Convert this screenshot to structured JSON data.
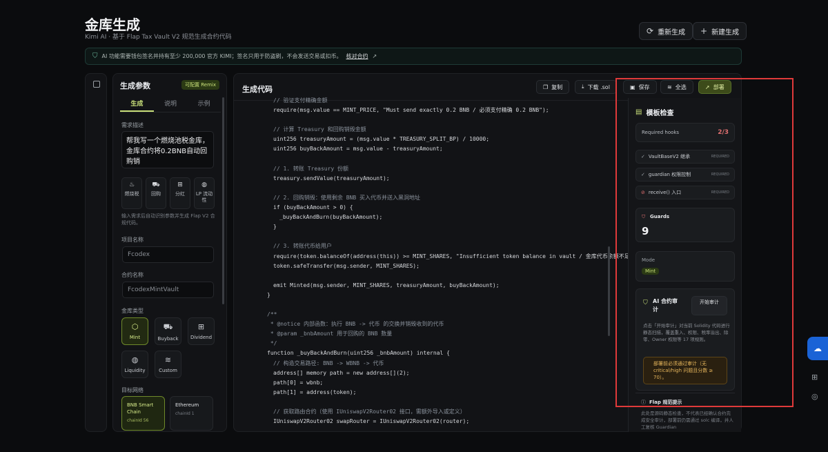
{
  "header": {
    "title": "金库生成",
    "subtitle": "Kimi AI · 基于 Flap Tax Vault V2 规范生成合约代码",
    "regenerate_label": "重新生成",
    "new_label": "新建生成"
  },
  "notice": {
    "text": "AI 功能需要钱包签名并持有至少 200,000 官方 KIMI；签名只用于防盗刷，不会发送交易或扣币。",
    "link": "核对合约"
  },
  "params": {
    "title": "生成参数",
    "badge": "可配置 Remix",
    "tabs": [
      "生成",
      "说明",
      "示例"
    ],
    "request_label": "需求描述",
    "request_value": "帮我写一个燃烧池税金库，金库合约将0.2BNB自动回购销",
    "quick": [
      {
        "icon": "flame-icon",
        "label": "燃烧税"
      },
      {
        "icon": "cart-icon",
        "label": "回购"
      },
      {
        "icon": "gift-icon",
        "label": "分红"
      },
      {
        "icon": "drop-icon",
        "label": "LP 流动性"
      }
    ],
    "hint": "输入需求后自动识别参数并生成 Flap V2 合规代码。",
    "project_label": "项目名称",
    "project_placeholder": "Fcodex",
    "contract_label": "合约名称",
    "contract_placeholder": "FcodexMintVault",
    "vault_label": "金库类型",
    "vault_types": [
      "Mint",
      "Buyback",
      "Dividend",
      "Liquidity",
      "Custom"
    ],
    "network_label": "目标网络",
    "networks": [
      {
        "name": "BNB Smart Chain",
        "chain": "chainId 56"
      },
      {
        "name": "Ethereum",
        "chain": "chainId 1"
      }
    ]
  },
  "code": {
    "title": "生成代码",
    "copy_label": "复制",
    "download_label": "下载 .sol",
    "save_label": "保存",
    "select_all_label": "全选",
    "deploy_label": "部署",
    "lines": [
      {
        "indent": 3,
        "type": "com",
        "text": "// 验证支付精确金额"
      },
      {
        "indent": 3,
        "type": "code",
        "text": "require(msg.value == MINT_PRICE, \"Must send exactly 0.2 BNB / 必须支付精确 0.2 BNB\");"
      },
      {
        "indent": 0,
        "type": "code",
        "text": ""
      },
      {
        "indent": 3,
        "type": "com",
        "text": "// 计算 Treasury 和回购销毁金额"
      },
      {
        "indent": 3,
        "type": "code",
        "text": "uint256 treasuryAmount = (msg.value * TREASURY_SPLIT_BP) / 10000;"
      },
      {
        "indent": 3,
        "type": "code",
        "text": "uint256 buyBackAmount = msg.value - treasuryAmount;"
      },
      {
        "indent": 0,
        "type": "code",
        "text": ""
      },
      {
        "indent": 3,
        "type": "com",
        "text": "// 1. 转账 Treasury 份额"
      },
      {
        "indent": 3,
        "type": "code",
        "text": "treasury.sendValue(treasuryAmount);"
      },
      {
        "indent": 0,
        "type": "code",
        "text": ""
      },
      {
        "indent": 3,
        "type": "com",
        "text": "// 2. 回购销毁：使用剩余 BNB 买入代币并送入黑洞地址"
      },
      {
        "indent": 3,
        "type": "code",
        "text": "if (buyBackAmount > 0) {"
      },
      {
        "indent": 4,
        "type": "code",
        "text": "_buyBackAndBurn(buyBackAmount);"
      },
      {
        "indent": 3,
        "type": "code",
        "text": "}"
      },
      {
        "indent": 0,
        "type": "code",
        "text": ""
      },
      {
        "indent": 3,
        "type": "com",
        "text": "// 3. 转账代币给用户"
      },
      {
        "indent": 3,
        "type": "code",
        "text": "require(token.balanceOf(address(this)) >= MINT_SHARES, \"Insufficient token balance in vault / 金库代币余额不足\");"
      },
      {
        "indent": 3,
        "type": "code",
        "text": "token.safeTransfer(msg.sender, MINT_SHARES);"
      },
      {
        "indent": 0,
        "type": "code",
        "text": ""
      },
      {
        "indent": 3,
        "type": "code",
        "text": "emit Minted(msg.sender, MINT_SHARES, treasuryAmount, buyBackAmount);"
      },
      {
        "indent": 2,
        "type": "code",
        "text": "}"
      },
      {
        "indent": 0,
        "type": "code",
        "text": ""
      },
      {
        "indent": 2,
        "type": "com",
        "text": "/**"
      },
      {
        "indent": 2,
        "type": "com",
        "text": " * @notice 内部函数：执行 BNB -> 代币 的交换并销毁收到的代币"
      },
      {
        "indent": 2,
        "type": "com",
        "text": " * @param _bnbAmount 用于回购的 BNB 数量"
      },
      {
        "indent": 2,
        "type": "com",
        "text": " */"
      },
      {
        "indent": 2,
        "type": "code",
        "text": "function _buyBackAndBurn(uint256 _bnbAmount) internal {"
      },
      {
        "indent": 3,
        "type": "com",
        "text": "// 构造交易路径: BNB -> WBNB -> 代币"
      },
      {
        "indent": 3,
        "type": "code",
        "text": "address[] memory path = new address[](2);"
      },
      {
        "indent": 3,
        "type": "code",
        "text": "path[0] = wbnb;"
      },
      {
        "indent": 3,
        "type": "code",
        "text": "path[1] = address(token);"
      },
      {
        "indent": 0,
        "type": "code",
        "text": ""
      },
      {
        "indent": 3,
        "type": "com",
        "text": "// 获取路由合约（使用 IUniswapV2Router02 接口，需额外导入或定义）"
      },
      {
        "indent": 3,
        "type": "code",
        "text": "IUniswapV2Router02 swapRouter = IUniswapV2Router02(router);"
      }
    ]
  },
  "inspector": {
    "title": "模板检查",
    "hooks_label": "Required hooks",
    "hooks_value": "2/3",
    "checks": [
      {
        "label": "VaultBaseV2 继承",
        "tag": "REQUIRED",
        "status": "ok"
      },
      {
        "label": "guardian 权限控制",
        "tag": "REQUIRED",
        "status": "ok"
      },
      {
        "label": "receive() 入口",
        "tag": "REQUIRED",
        "status": "warn"
      }
    ],
    "guards_label": "Guards",
    "guards_value": "9",
    "mode_label": "Mode",
    "mode_value": "Mint",
    "audit_title": "AI 合约审计",
    "audit_button": "开始审计",
    "audit_desc": "点击「开始审计」对当前 Solidity 代码进行静态扫描，覆盖重入、权限、税率溢出、除零、Owner 权限等 17 项规则。",
    "audit_warning": "部署前必须通过审计（无 critical/high 问题且分数 ≥ 70）。",
    "flap_title": "Flap 规范提示",
    "flap_desc": "此处是源码静态检查，不代表已经确认合约完成安全审计，部署前仍需通过 solc 编译，并人工复核 Guardian"
  },
  "colors": {
    "accent": "#c9e07a",
    "highlight": "#e03a3a",
    "warning": "#e8b75c"
  }
}
